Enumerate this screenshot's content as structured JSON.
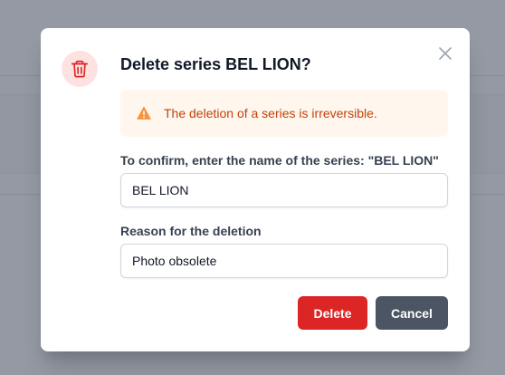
{
  "dialog": {
    "title": "Delete series BEL LION?",
    "warning": "The deletion of a series is irreversible.",
    "confirm_label": "To confirm, enter the name of the series: \"BEL LION\"",
    "confirm_value": "BEL LION",
    "reason_label": "Reason for the deletion",
    "reason_value": "Photo obsolete",
    "delete_label": "Delete",
    "cancel_label": "Cancel",
    "icons": {
      "header": "trash-icon",
      "close": "close-icon",
      "warning": "warning-icon"
    }
  },
  "colors": {
    "danger": "#dc2626",
    "danger_soft": "#fee2e2",
    "warning_bg": "#fff7ed",
    "warning_text": "#c2410c",
    "warning_icon": "#fb923c",
    "secondary": "#4b5563",
    "overlay": "#6b7280"
  }
}
